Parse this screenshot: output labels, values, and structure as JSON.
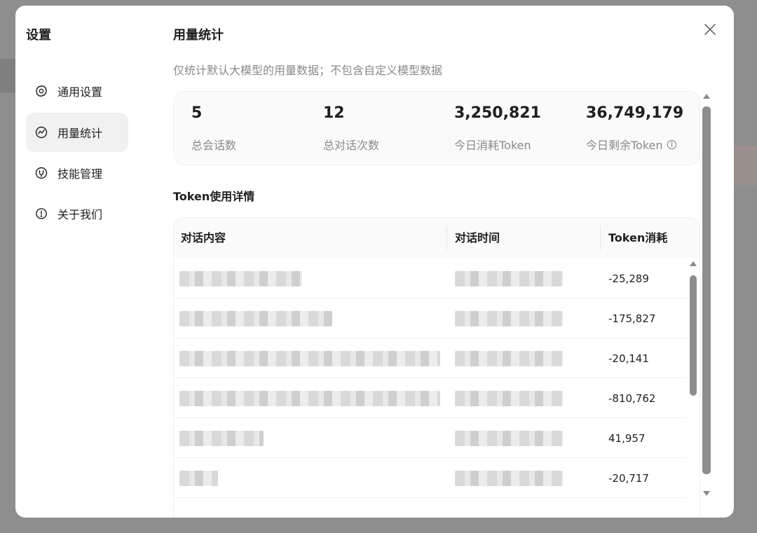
{
  "sidebar": {
    "title": "设置",
    "items": [
      {
        "label": "通用设置",
        "icon": "gear-icon",
        "active": false
      },
      {
        "label": "用量统计",
        "icon": "chart-icon",
        "active": true
      },
      {
        "label": "技能管理",
        "icon": "skill-icon",
        "active": false
      },
      {
        "label": "关于我们",
        "icon": "info-icon",
        "active": false
      }
    ]
  },
  "main": {
    "title": "用量统计",
    "subtitle": "仅统计默认大模型的用量数据；不包含自定义模型数据",
    "stats": [
      {
        "value": "5",
        "label": "总会话数"
      },
      {
        "value": "12",
        "label": "总对话次数"
      },
      {
        "value": "3,250,821",
        "label": "今日消耗Token"
      },
      {
        "value": "36,749,179",
        "label": "今日剩余Token"
      }
    ],
    "section_title": "Token使用详情",
    "table": {
      "columns": [
        "对话内容",
        "对话时间",
        "Token消耗"
      ],
      "rows": [
        {
          "tokens": "-25,289"
        },
        {
          "tokens": "-175,827"
        },
        {
          "tokens": "-20,141"
        },
        {
          "tokens": "-810,762"
        },
        {
          "tokens": "41,957"
        },
        {
          "tokens": "-20,717"
        }
      ]
    }
  },
  "colors": {
    "active_nav_bg": "#f1f1f1",
    "muted_text": "#8a8a8a",
    "scroll_thumb": "#8d8d8d",
    "overlay": "#8e8e8e"
  }
}
